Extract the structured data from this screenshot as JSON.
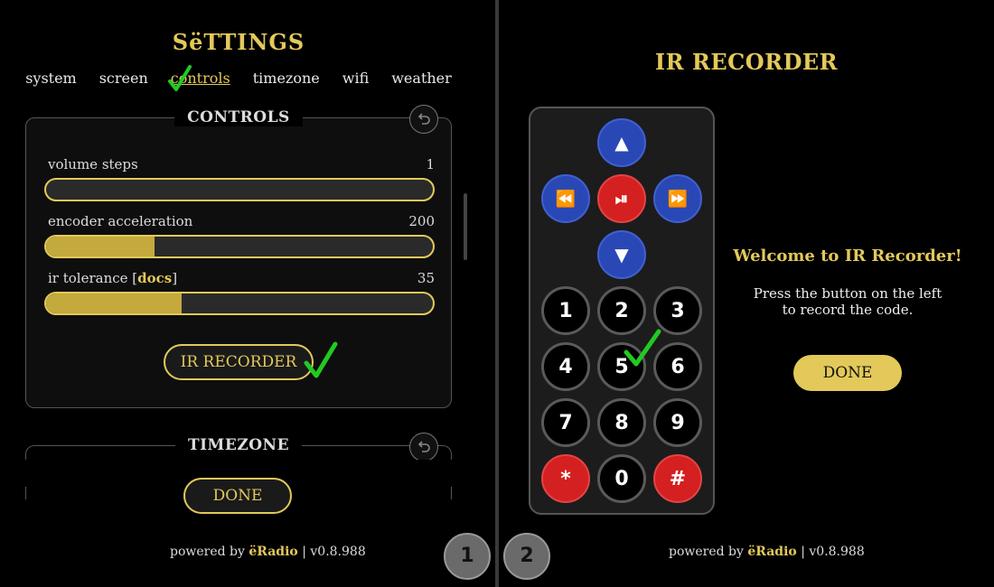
{
  "settings": {
    "title": "SëTTINGS",
    "tabs": [
      "system",
      "screen",
      "controls",
      "timezone",
      "wifi",
      "weather"
    ],
    "active_tab": "controls"
  },
  "controls": {
    "legend": "CONTROLS",
    "sliders": [
      {
        "label": "volume steps",
        "value": "1",
        "fill_fraction": 0.0
      },
      {
        "label": "encoder acceleration",
        "value": "200",
        "fill_fraction": 0.28
      },
      {
        "label_prefix": "ir tolerance [",
        "label_link": "docs",
        "label_suffix": "]",
        "value": "35",
        "fill_fraction": 0.35
      }
    ],
    "ir_button": "IR RECORDER"
  },
  "timezone": {
    "legend": "TIMEZONE"
  },
  "left_done": "DONE",
  "footer": {
    "prefix": "powered by ",
    "brand": "ëRadio",
    "version": " | v0.8.988"
  },
  "pager": [
    "1",
    "2"
  ],
  "ir": {
    "title": "IR RECORDER",
    "welcome": "Welcome to IR Recorder!",
    "instruction_line1": "Press the button on the left",
    "instruction_line2": "to record the code.",
    "done": "DONE",
    "remote_keys": [
      "▲",
      "⏪",
      "⏯",
      "⏩",
      "▼",
      "1",
      "2",
      "3",
      "4",
      "5",
      "6",
      "7",
      "8",
      "9",
      "*",
      "0",
      "#"
    ]
  },
  "colors": {
    "accent": "#e3c95a",
    "blue": "#2a48b5",
    "red": "#d42020",
    "check": "#22c922"
  },
  "icons": [
    "undo-icon",
    "checkmark-icon",
    "arrow-up-icon",
    "arrow-down-icon",
    "rewind-icon",
    "play-pause-icon",
    "fast-forward-icon"
  ]
}
